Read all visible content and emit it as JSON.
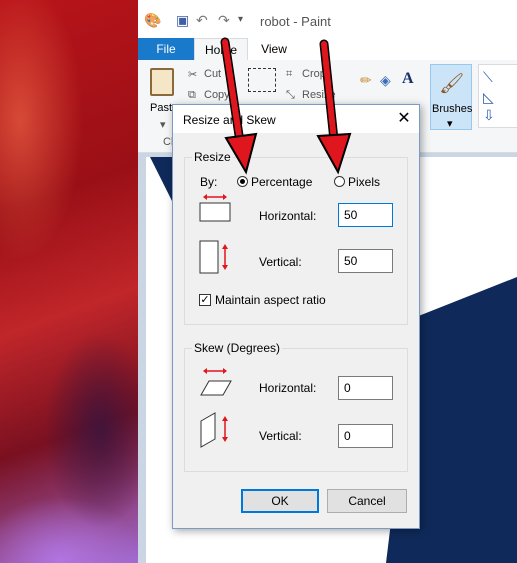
{
  "window": {
    "title": "robot - Paint"
  },
  "tabs": [
    {
      "label": "File"
    },
    {
      "label": "Home"
    },
    {
      "label": "View"
    }
  ],
  "ribbon": {
    "paste_label": "Paste",
    "cut_label": "Cut",
    "copy_label": "Copy",
    "crop_label": "Crop",
    "resize_label": "Resize",
    "brushes_label": "Brushes",
    "clipboard_group_label": "Cl"
  },
  "dialog": {
    "title": "Resize and Skew",
    "resize_group": {
      "label": "Resize",
      "by_label": "By:",
      "percentage_label": "Percentage",
      "pixels_label": "Pixels",
      "selected_unit": "Percentage",
      "horizontal_label": "Horizontal:",
      "horizontal_value": "50",
      "vertical_label": "Vertical:",
      "vertical_value": "50",
      "maintain_label": "Maintain aspect ratio",
      "maintain_checked": true
    },
    "skew_group": {
      "label": "Skew (Degrees)",
      "horizontal_label": "Horizontal:",
      "horizontal_value": "0",
      "vertical_label": "Vertical:",
      "vertical_value": "0"
    },
    "ok_label": "OK",
    "cancel_label": "Cancel"
  },
  "colors": {
    "file_tab": "#1979ca",
    "canvas_navy": "#0f2a5a",
    "arrow": "#e0161e",
    "resize_arrow_icon": "#e0161e"
  },
  "icons": [
    "paint-app-icon",
    "save-icon",
    "undo-icon",
    "redo-icon",
    "customize-qa-icon",
    "scissors-icon",
    "copy-icon",
    "crop-icon",
    "resize-icon",
    "pencil-icon",
    "fill-icon",
    "text-icon",
    "brush-icon",
    "close-icon"
  ]
}
